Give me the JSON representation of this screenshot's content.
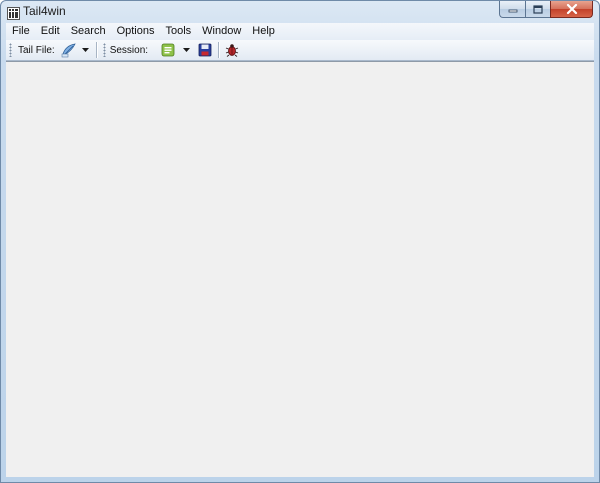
{
  "window": {
    "title": "Tail4win"
  },
  "menubar": {
    "items": [
      "File",
      "Edit",
      "Search",
      "Options",
      "Tools",
      "Window",
      "Help"
    ]
  },
  "toolbar": {
    "tail_file_label": "Tail File:",
    "session_label": "Session:",
    "icons": [
      "open-file-icon",
      "dropdown-arrow-icon",
      "session-icon",
      "dropdown-arrow-icon",
      "save-icon",
      "bug-icon"
    ]
  },
  "colors": {
    "frame": "#bcd3ea",
    "content_bg": "#f0f0f0",
    "close_button": "#c3412a"
  }
}
